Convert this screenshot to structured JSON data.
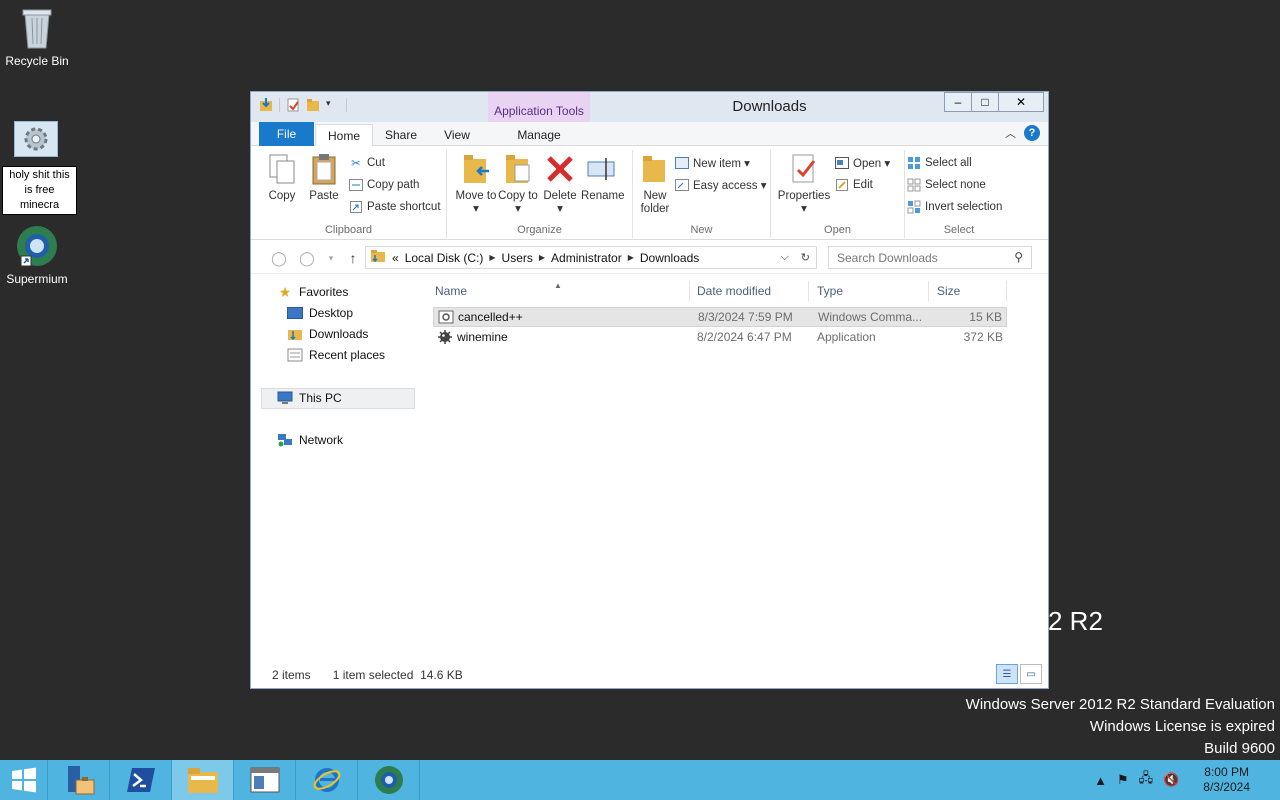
{
  "desktop": {
    "icons": [
      {
        "label": "Recycle Bin",
        "icon": "recycle-bin-icon"
      },
      {
        "label": "Supermium",
        "icon": "supermium-icon"
      }
    ],
    "rename_text": "holy shit this is free minecra"
  },
  "watermark": {
    "r2": "2 R2",
    "line1": "Windows Server 2012 R2 Standard Evaluation",
    "line2": "Windows License is expired",
    "line3": "Build 9600"
  },
  "window": {
    "title": "Downloads",
    "context_tab": "Application Tools",
    "controls": {
      "minimize": "–",
      "maximize": "□",
      "close": "✕"
    },
    "tabs": [
      "File",
      "Home",
      "Share",
      "View",
      "Manage"
    ],
    "help": "?",
    "ribbon": {
      "clipboard": {
        "label": "Clipboard",
        "copy": "Copy",
        "paste": "Paste",
        "cut": "Cut",
        "copy_path": "Copy path",
        "paste_shortcut": "Paste shortcut"
      },
      "organize": {
        "label": "Organize",
        "move_to": "Move to ▾",
        "copy_to": "Copy to ▾",
        "delete": "Delete ▾",
        "rename": "Rename"
      },
      "new": {
        "label": "New",
        "new_folder": "New folder",
        "new_item": "New item ▾",
        "easy_access": "Easy access ▾"
      },
      "open": {
        "label": "Open",
        "properties": "Properties ▾",
        "open": "Open ▾",
        "edit": "Edit"
      },
      "select": {
        "label": "Select",
        "select_all": "Select all",
        "select_none": "Select none",
        "invert": "Invert selection"
      }
    },
    "address": {
      "prefix": "«",
      "crumbs": [
        "Local Disk (C:)",
        "Users",
        "Administrator",
        "Downloads"
      ],
      "search_placeholder": "Search Downloads"
    },
    "nav": {
      "favorites": "Favorites",
      "desktop": "Desktop",
      "downloads": "Downloads",
      "recent": "Recent places",
      "this_pc": "This PC",
      "network": "Network"
    },
    "columns": [
      "Name",
      "Date modified",
      "Type",
      "Size"
    ],
    "files": [
      {
        "name": "cancelled++",
        "date": "8/3/2024 7:59 PM",
        "type": "Windows Comma...",
        "size": "15 KB"
      },
      {
        "name": "winemine",
        "date": "8/2/2024 6:47 PM",
        "type": "Application",
        "size": "372 KB"
      }
    ],
    "status": {
      "items": "2 items",
      "selected": "1 item selected  14.6 KB"
    }
  },
  "taskbar": {
    "time": "8:00 PM",
    "date": "8/3/2024"
  },
  "colors": {
    "accent": "#1979ca",
    "taskbar": "#4fb5e0",
    "context": "#e9d3f2"
  }
}
